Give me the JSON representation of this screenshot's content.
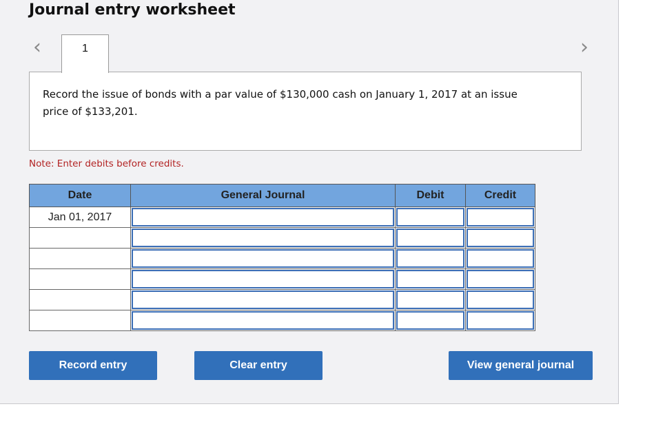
{
  "header": {
    "title": "Journal entry worksheet"
  },
  "navigation": {
    "prev_icon": "chevron-left-icon",
    "prev_glyph": "‹",
    "next_icon": "chevron-right-icon",
    "next_glyph": "›",
    "tabs": [
      {
        "label": "1",
        "active": true
      }
    ]
  },
  "question": {
    "text": "Record the issue of bonds with a par value of $130,000 cash on January 1, 2017 at an issue price of $133,201."
  },
  "note": "Note: Enter debits before credits.",
  "journal_table": {
    "columns": [
      "Date",
      "General Journal",
      "Debit",
      "Credit"
    ],
    "rows": [
      {
        "date": "Jan 01, 2017",
        "account": "",
        "debit": "",
        "credit": ""
      },
      {
        "date": "",
        "account": "",
        "debit": "",
        "credit": ""
      },
      {
        "date": "",
        "account": "",
        "debit": "",
        "credit": ""
      },
      {
        "date": "",
        "account": "",
        "debit": "",
        "credit": ""
      },
      {
        "date": "",
        "account": "",
        "debit": "",
        "credit": ""
      },
      {
        "date": "",
        "account": "",
        "debit": "",
        "credit": ""
      }
    ]
  },
  "buttons": {
    "record": "Record entry",
    "clear": "Clear entry",
    "view": "View general journal"
  },
  "colors": {
    "header_bg": "#72a5de",
    "button_bg": "#3170ba",
    "input_border": "#3a6db5",
    "note_text": "#b22222"
  }
}
